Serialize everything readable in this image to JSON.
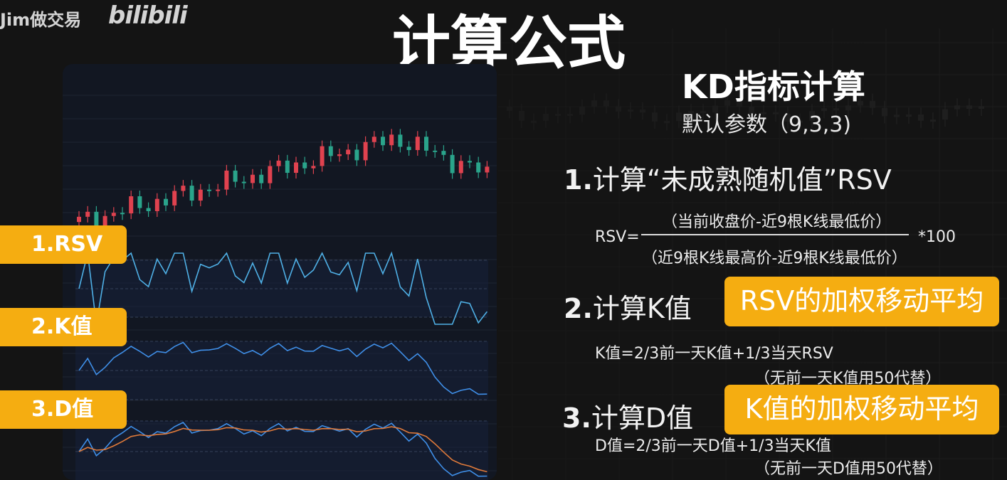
{
  "watermark": {
    "channel": "Jim做交易",
    "logo": "bilibili"
  },
  "title": "计算公式",
  "tags": [
    "1.RSV",
    "2.K值",
    "3.D值"
  ],
  "heading": "KD指标计算",
  "params": "默认参数（9,3,3)",
  "step1": {
    "num": "1.",
    "text": "计算“未成熟随机值”RSV"
  },
  "rsv": {
    "lhs": "RSV=",
    "numerator": "（当前收盘价-近9根K线最低价）",
    "denominator": "（近9根K线最高价-近9根K线最低价）",
    "multiplier": "*100"
  },
  "step2": {
    "num": "2.",
    "text": "计算K值",
    "highlight": "RSV的加权移动平均"
  },
  "k_formula": "K值=2/3前一天K值+1/3当天RSV",
  "k_note": "（无前一天K值用50代替）",
  "step3": {
    "num": "3.",
    "text": "计算D值",
    "highlight": "K值的加权移动平均"
  },
  "d_formula": "D值=2/3前一天D值+1/3当天K值",
  "d_note": "（无前一天D值用50代替）",
  "colors": {
    "accent": "#f5ad11",
    "up": "#e0424f",
    "down": "#2aa48b",
    "rsv_line": "#4fb0e6",
    "k_line": "#3f8fe8",
    "d_line": "#e07a3a"
  }
}
